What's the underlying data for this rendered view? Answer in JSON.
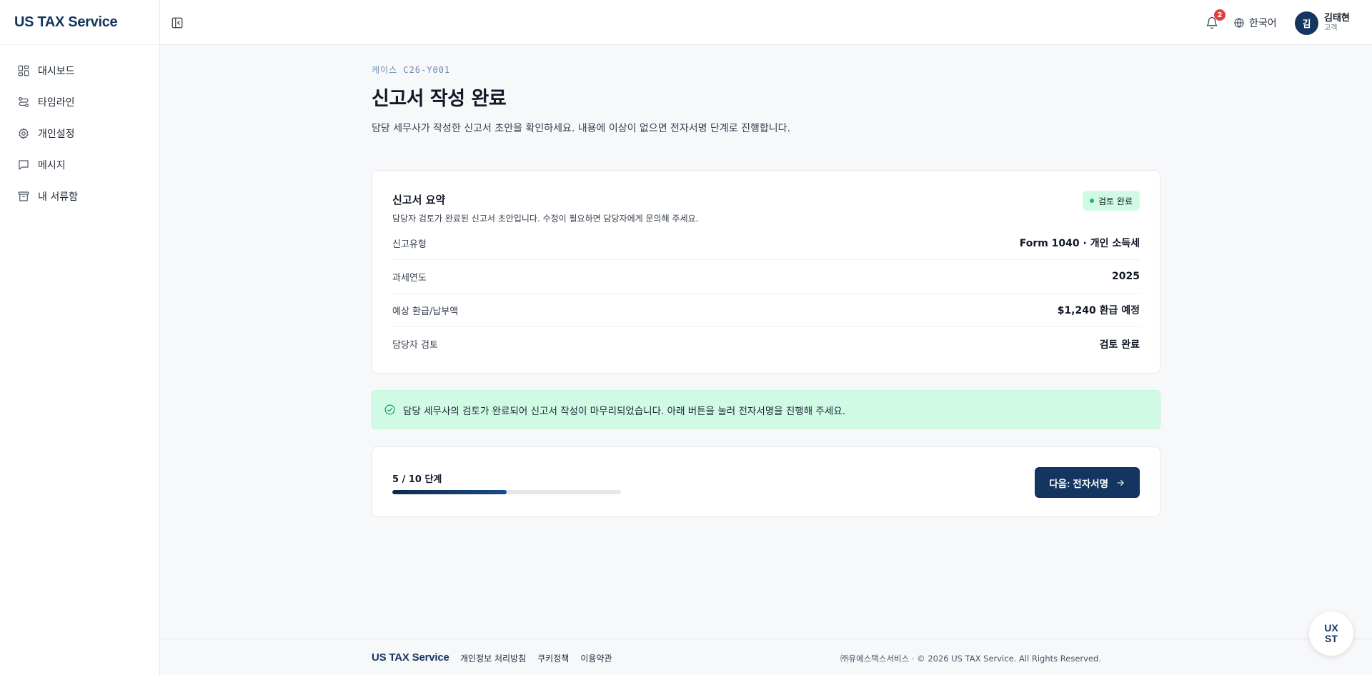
{
  "brand": "US TAX Service",
  "sidebar": {
    "items": [
      {
        "label": "대시보드",
        "icon": "dashboard-icon"
      },
      {
        "label": "타임라인",
        "icon": "timeline-icon"
      },
      {
        "label": "개인설정",
        "icon": "gear-icon"
      },
      {
        "label": "메시지",
        "icon": "message-icon"
      },
      {
        "label": "내 서류함",
        "icon": "archive-icon"
      }
    ]
  },
  "header": {
    "notification_count": "2",
    "language": "한국어",
    "user": {
      "initial": "김",
      "name": "김태현",
      "role": "고객"
    }
  },
  "main": {
    "case_no": "케이스 C26-Y001",
    "title": "신고서 작성 완료",
    "description": "담당 세무사가 작성한 신고서 초안을 확인하세요. 내용에 이상이 없으면 전자서명 단계로 진행합니다.",
    "summary": {
      "title": "신고서 요약",
      "subtitle": "담당자 검토가 완료된 신고서 초안입니다. 수정이 필요하면 담당자에게 문의해 주세요.",
      "status": "검토 완료",
      "rows": [
        {
          "label": "신고유형",
          "value": "Form 1040 · 개인 소득세"
        },
        {
          "label": "과세연도",
          "value": "2025"
        },
        {
          "label": "예상 환급/납부액",
          "value": "$1,240 환급 예정"
        },
        {
          "label": "담당자 검토",
          "value": "검토 완료"
        }
      ]
    },
    "notice": "담당 세무사의 검토가 완료되어 신고서 작성이 마무리되었습니다. 아래 버튼을 눌러 전자서명을 진행해 주세요.",
    "progress": {
      "label": "5 / 10 단계",
      "current": 5,
      "total": 10
    },
    "next_button": "다음: 전자서명"
  },
  "footer": {
    "brand": "US TAX Service",
    "links": [
      "개인정보 처리방침",
      "쿠키정책",
      "이용약관"
    ],
    "copyright": "㈜유에스택스서비스 · © 2026 US TAX Service. All Rights Reserved."
  },
  "fab": {
    "line1": "UX",
    "line2": "ST"
  },
  "colors": {
    "brand": "#13355f",
    "success_bg": "#d1fae5",
    "success": "#10b981",
    "badge": "#e53e3e"
  }
}
